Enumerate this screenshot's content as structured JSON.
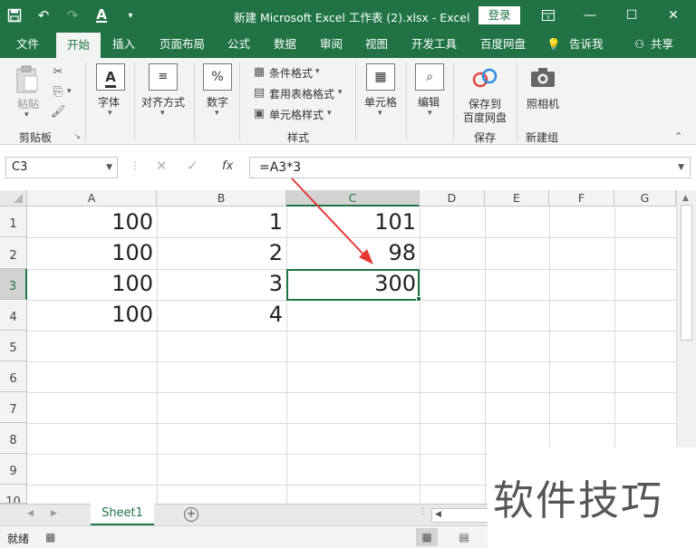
{
  "title_bar": {
    "title": "新建 Microsoft Excel 工作表 (2).xlsx  -  Excel",
    "login_label": "登录",
    "qat_icons": [
      "save-icon",
      "undo-icon",
      "redo-icon",
      "font-color-icon",
      "customize-icon"
    ],
    "window_icons": [
      "ribbon-display-icon",
      "minimize-icon",
      "maximize-icon",
      "close-icon"
    ]
  },
  "tabs": {
    "file": "文件",
    "home": "开始",
    "insert": "插入",
    "page_layout": "页面布局",
    "formulas": "公式",
    "data": "数据",
    "review": "审阅",
    "view": "视图",
    "developer": "开发工具",
    "baidu": "百度网盘",
    "tell_me": "告诉我",
    "share": "共享"
  },
  "ribbon": {
    "paste": "粘贴",
    "clipboard": "剪贴板",
    "font": "字体",
    "alignment": "对齐方式",
    "number": "数字",
    "conditional_format": "条件格式",
    "table_format": "套用表格格式",
    "cell_styles": "单元格样式",
    "styles": "样式",
    "cells": "单元格",
    "editing": "编辑",
    "save_to": "保存到",
    "baidu_pan": "百度网盘",
    "save_group": "保存",
    "camera": "照相机",
    "new_group": "新建组"
  },
  "formula_bar": {
    "name_box": "C3",
    "formula": "=A3*3"
  },
  "columns": [
    "A",
    "B",
    "C",
    "D",
    "E",
    "F",
    "G"
  ],
  "rows": [
    "1",
    "2",
    "3",
    "4",
    "5",
    "6",
    "7",
    "8",
    "9",
    "10"
  ],
  "cells": {
    "a": [
      "100",
      "100",
      "100",
      "100"
    ],
    "b": [
      "1",
      "2",
      "3",
      "4"
    ],
    "c": [
      "101",
      "98",
      "300"
    ]
  },
  "sheet_tab": "Sheet1",
  "status": {
    "ready": "就绪"
  },
  "watermark": "软件技巧",
  "accent_color": "#217346",
  "arrow_color": "#e53935"
}
